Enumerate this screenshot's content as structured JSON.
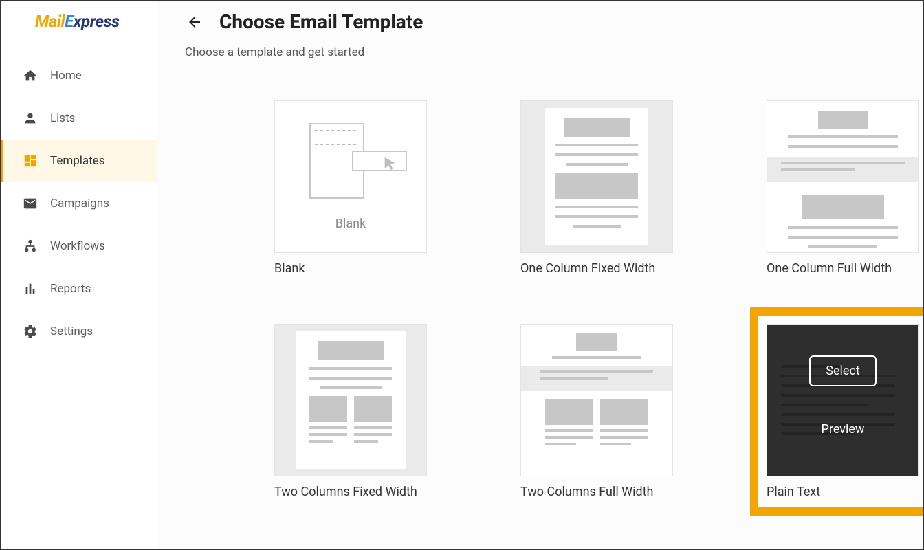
{
  "brand": {
    "part1": "Mail",
    "part2": "E",
    "part3": "xpress"
  },
  "sidebar": {
    "items": [
      {
        "label": "Home"
      },
      {
        "label": "Lists"
      },
      {
        "label": "Templates"
      },
      {
        "label": "Campaigns"
      },
      {
        "label": "Workflows"
      },
      {
        "label": "Reports"
      },
      {
        "label": "Settings"
      }
    ]
  },
  "header": {
    "title": "Choose Email Template",
    "subtitle": "Choose a template and get started"
  },
  "templates": [
    {
      "label": "Blank",
      "thumb_text": "Blank"
    },
    {
      "label": "One Column Fixed Width"
    },
    {
      "label": "One Column Full Width"
    },
    {
      "label": "Two Columns Fixed Width"
    },
    {
      "label": "Two Columns Full Width"
    },
    {
      "label": "Plain Text"
    }
  ],
  "overlay": {
    "select": "Select",
    "preview": "Preview"
  }
}
